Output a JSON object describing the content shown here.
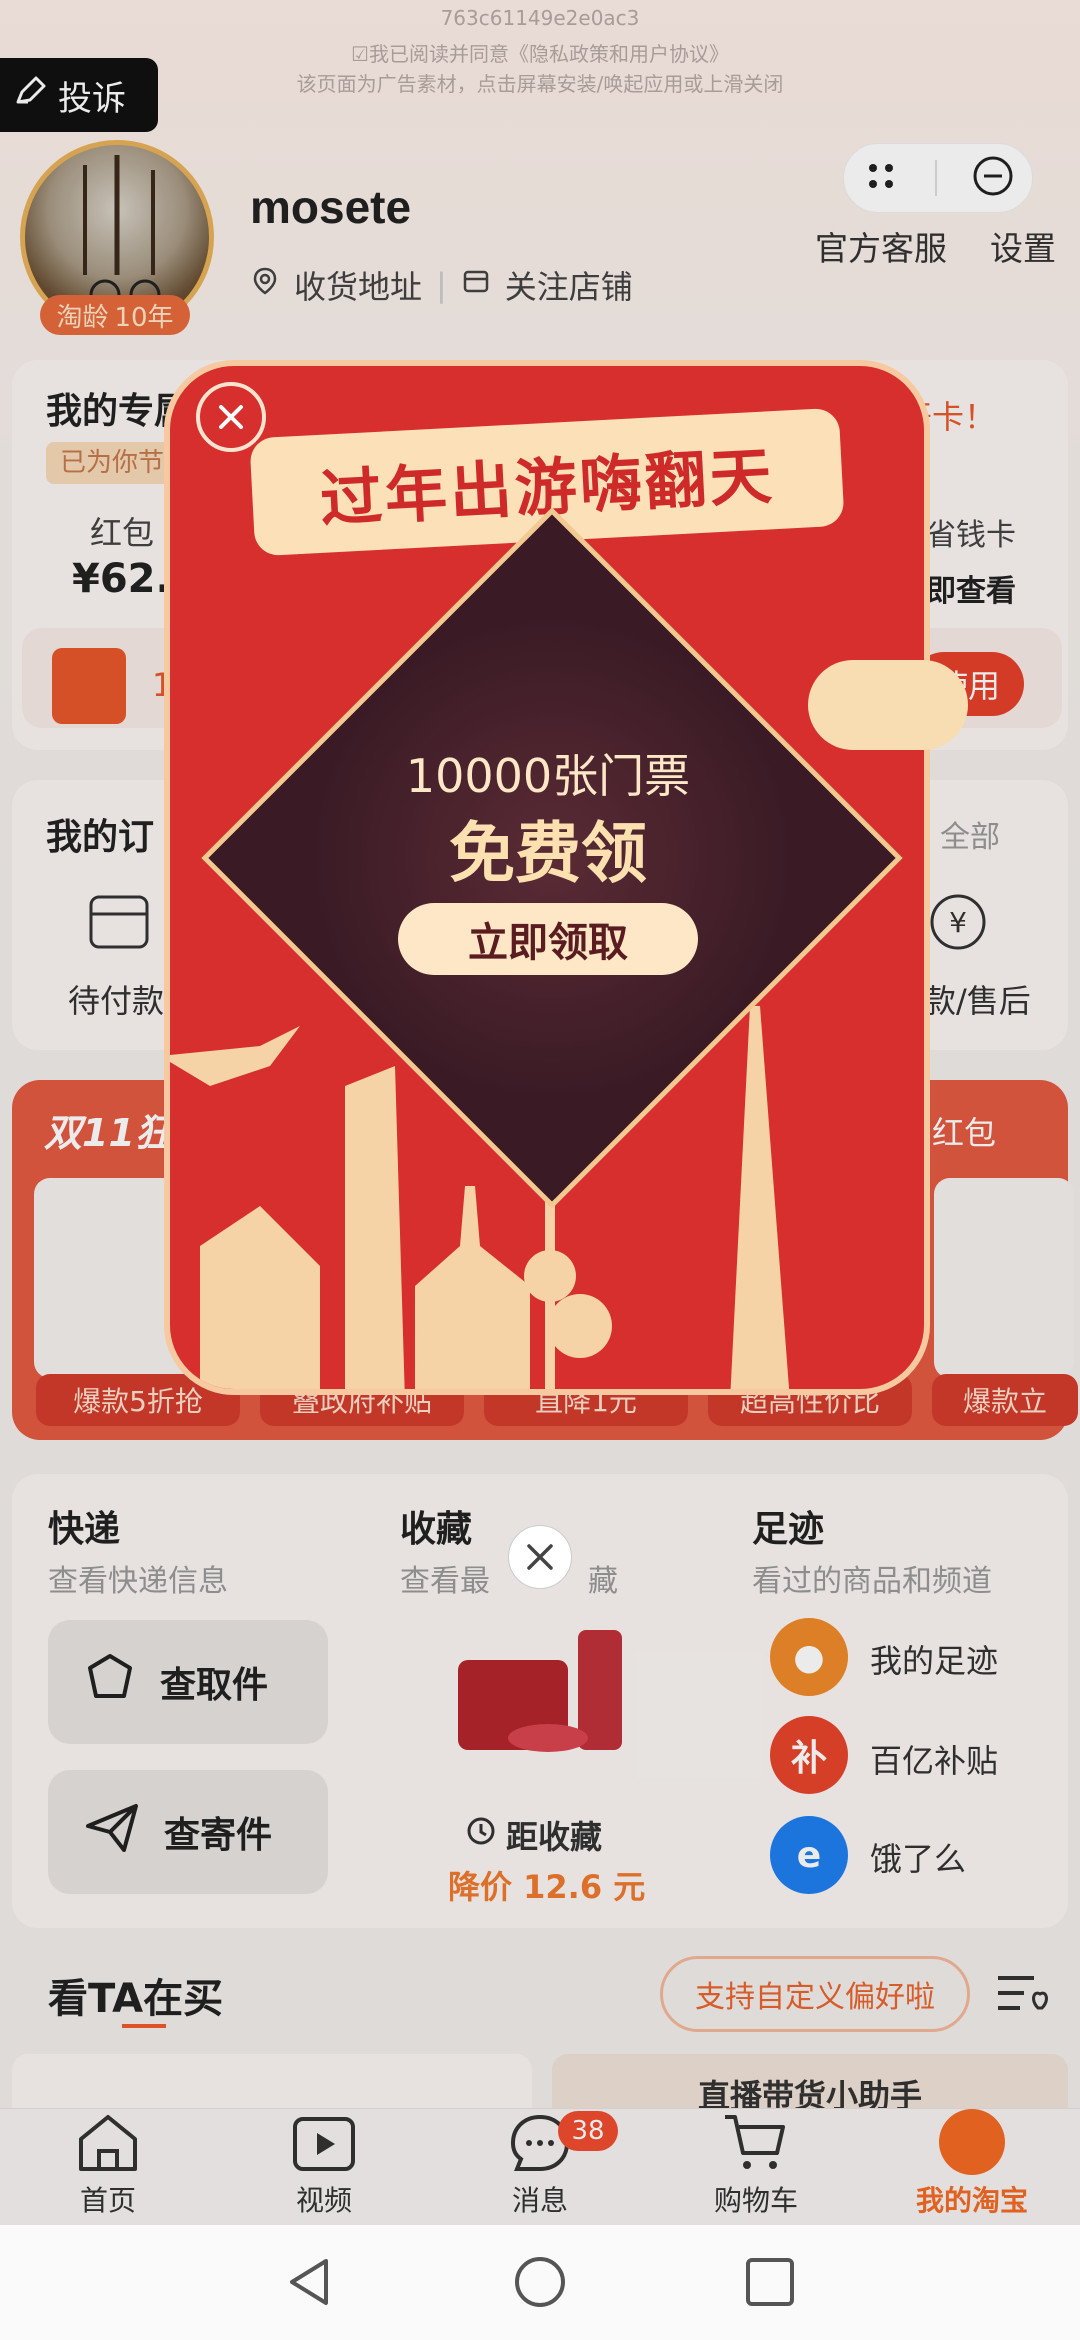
{
  "ad_header": {
    "id_code": "763c61149e2e0ac3",
    "agreement": "☑我已阅读并同意《隐私政策和用户协议》",
    "notice": "该页面为广告素材，点击屏幕安装/唤起应用或上滑关闭"
  },
  "complain_label": "投诉",
  "profile": {
    "username": "mosete",
    "badge_label": "淘龄",
    "badge_years": "10年",
    "address_link": "收货地址",
    "follow_link": "关注店铺"
  },
  "top_links": {
    "service": "官方客服",
    "settings": "设置"
  },
  "exclusive": {
    "title": "我的专属",
    "tag": "已为你节",
    "open_card": "元开卡！",
    "redpacket_label": "红包",
    "redpacket_value": "¥62.2",
    "saving_card": "省钱卡",
    "view_now": "即查看",
    "use_button": "使用",
    "coupon_prefix": "1"
  },
  "orders": {
    "title": "我的订",
    "all_link": "全部",
    "pending_pay": "待付款",
    "refund": "款/售后"
  },
  "promo_banner": {
    "title": "双11狂",
    "right_link": "红包",
    "pills": [
      "爆款5折抢",
      "叠政府补贴",
      "直降1元",
      "超高性价比",
      "爆款立"
    ]
  },
  "services": {
    "express": {
      "title": "快递",
      "subtitle": "查看快递信息",
      "pickup": "查取件",
      "send": "查寄件"
    },
    "favorites": {
      "title": "收藏",
      "subtitle": "查看最",
      "subtitle_tail": "藏",
      "price_label": "距收藏",
      "price_drop": "降价 12.6 元"
    },
    "footprint": {
      "title": "足迹",
      "subtitle": "看过的商品和频道",
      "items": [
        "我的足迹",
        "百亿补贴",
        "饿了么"
      ]
    }
  },
  "watch_buy": {
    "title": "看TA在买",
    "pref_button": "支持自定义偏好啦",
    "live_card": "直播带货小助手"
  },
  "tabbar": {
    "tabs": [
      "首页",
      "视频",
      "消息",
      "购物车",
      "我的淘宝"
    ],
    "message_badge": "38"
  },
  "popup": {
    "ribbon": "过年出游嗨翻天",
    "line1": "10000张门票",
    "line2": "免费领",
    "button": "立即领取"
  },
  "colors": {
    "accent": "#d72f2d",
    "cream": "#fbe0b8",
    "orange": "#e76b3b"
  }
}
